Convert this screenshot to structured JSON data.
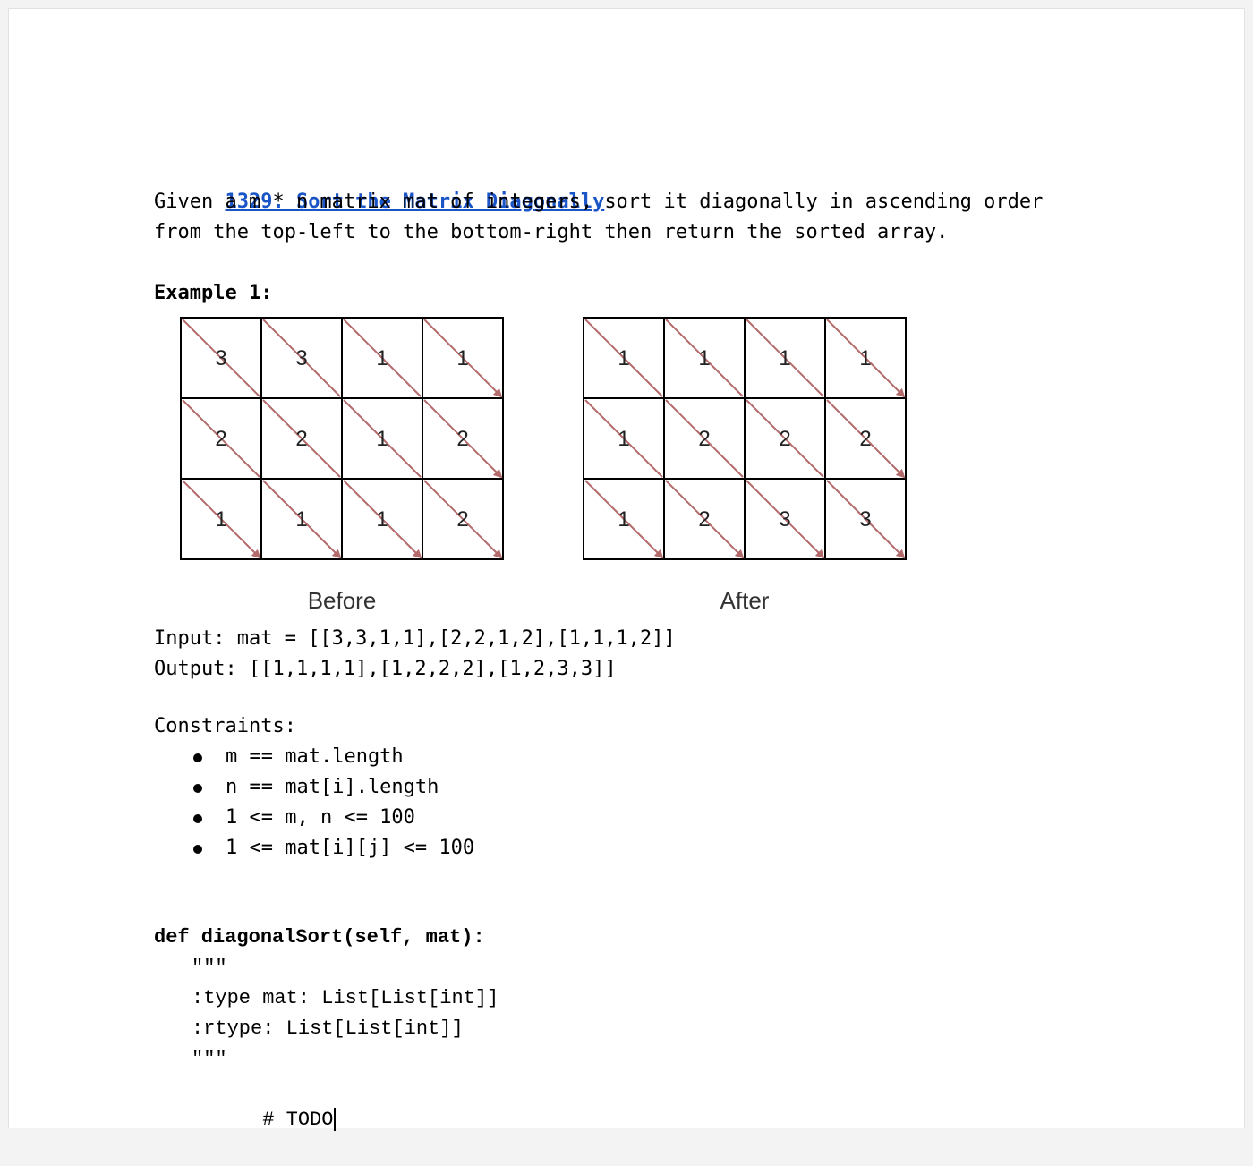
{
  "problem": {
    "title": "1329. Sort the Matrix Diagonally",
    "desc_line1": "Given a m * n matrix mat of integers, sort it diagonally in ascending order",
    "desc_line2": "from the top-left to the bottom-right then return the sorted array."
  },
  "example": {
    "heading": "Example 1:",
    "before_label": "Before",
    "after_label": "After",
    "before_matrix": [
      [
        3,
        3,
        1,
        1
      ],
      [
        2,
        2,
        1,
        2
      ],
      [
        1,
        1,
        1,
        2
      ]
    ],
    "after_matrix": [
      [
        1,
        1,
        1,
        1
      ],
      [
        1,
        2,
        2,
        2
      ],
      [
        1,
        2,
        3,
        3
      ]
    ],
    "arrow_color": "#b36b6b",
    "input_line": "Input: mat = [[3,3,1,1],[2,2,1,2],[1,1,1,2]]",
    "output_line": "Output: [[1,1,1,1],[1,2,2,2],[1,2,3,3]]"
  },
  "constraints": {
    "heading": "Constraints:",
    "items": [
      "m == mat.length",
      "n == mat[i].length",
      "1 <= m, n <= 100",
      "1 <= mat[i][j] <= 100"
    ]
  },
  "code": {
    "signature": "def diagonalSort(self, mat):",
    "doc_open": "\"\"\"",
    "type_line": ":type mat: List[List[int]]",
    "rtype_line": ":rtype: List[List[int]]",
    "doc_close": "\"\"\"",
    "todo": "# TODO"
  },
  "colors": {
    "link": "#1a55c7",
    "text": "#000000"
  }
}
